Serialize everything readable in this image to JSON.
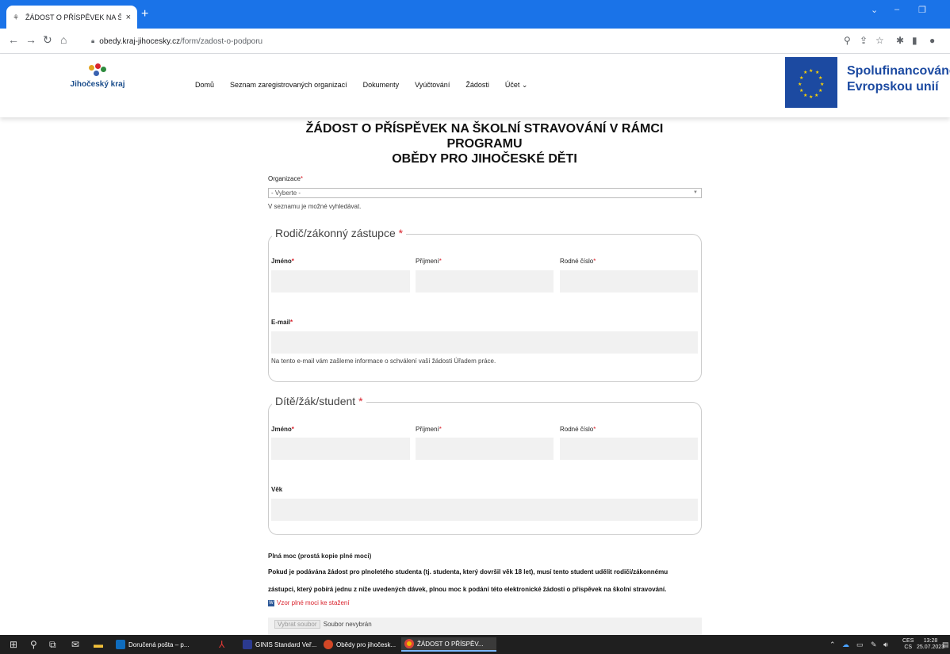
{
  "browser": {
    "tab_title": "ŽÁDOST O PŘÍSPĚVEK NA ŠKOLNÍ...",
    "tab_close": "×",
    "new_tab": "+",
    "url_host": "obedy.kraj-jihocesky.cz",
    "url_path": "/form/zadost-o-podporu"
  },
  "site": {
    "logo_text": "Jihočeský kraj",
    "nav": [
      "Domů",
      "Seznam zaregistrovaných organizací",
      "Dokumenty",
      "Vyúčtování",
      "Žádosti",
      "Účet ⌄"
    ],
    "eu_line1": "Spolufinancováno",
    "eu_line2": "Evropskou unií"
  },
  "form": {
    "title_line1": "ŽÁDOST O PŘÍSPĚVEK NA ŠKOLNÍ STRAVOVÁNÍ V RÁMCI PROGRAMU",
    "title_line2": "OBĚDY PRO JIHOČESKÉ DĚTI",
    "organizace_label": "Organizace",
    "organizace_value": "- Vyberte -",
    "organizace_hint": "V seznamu je možné vyhledávat.",
    "req_mark": "*",
    "parent": {
      "legend": "Rodič/zákonný zástupce",
      "jmeno": "Jméno",
      "prijmeni": "Příjmení",
      "rodne_cislo": "Rodné číslo",
      "email": "E-mail",
      "email_hint": "Na tento e-mail vám zašleme informace o schválení vaší žádosti Úřadem práce."
    },
    "child": {
      "legend": "Dítě/žák/student",
      "jmeno": "Jméno",
      "prijmeni": "Příjmení",
      "rodne_cislo": "Rodné číslo",
      "vek": "Věk"
    },
    "plna_moc_label": "Plná moc (prostá kopie plné moci)",
    "plna_moc_text_1": "Pokud je podávána žádost pro plnoletého studenta (tj. studenta, který dovršil věk 18 let), musí tento student udělit rodiči/zákonnému",
    "plna_moc_text_2": "zástupci, který pobírá jednu z níže uvedených dávek, plnou moc k podání této elektronické žádosti o příspěvek na školní stravování.",
    "download_link": "Vzor plné moci ke stažení",
    "file_button": "Vybrat soubor",
    "file_status": "Soubor nevybrán"
  },
  "taskbar": {
    "items": [
      "Doručená pošta – p...",
      "GINIS Standard Veř...",
      "Obědy pro jihočesk...",
      "ŽÁDOST O PŘÍSPĚV..."
    ],
    "lang1": "CES",
    "lang2": "CS",
    "time": "13:28",
    "date": "25.07.2023"
  }
}
